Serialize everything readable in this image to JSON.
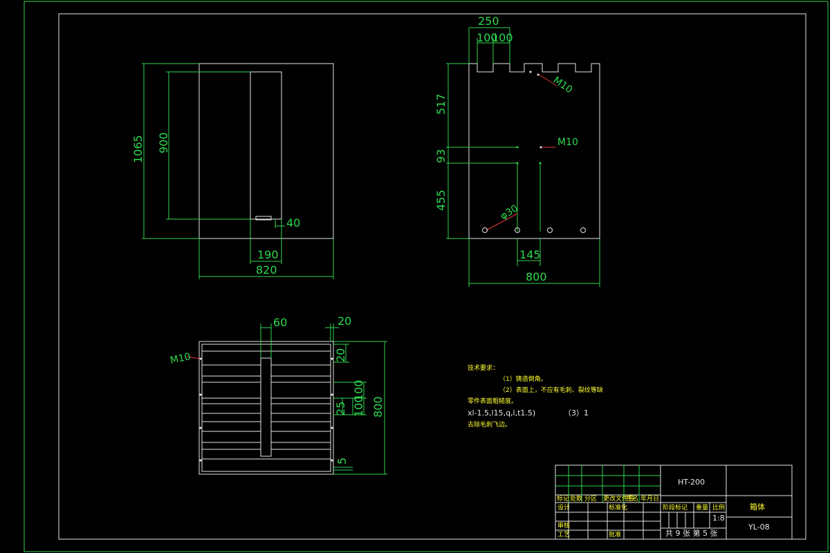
{
  "front_view": {
    "dim_height": "1065",
    "dim_inner": "900",
    "dim_gap": "40",
    "dim_slot": "190",
    "dim_width": "820"
  },
  "side_view": {
    "dim_top": "250",
    "dim_tab_a": "100",
    "dim_tab_b": "100",
    "dim_upper": "517",
    "dim_mid": "93",
    "dim_lower": "455",
    "dim_spacing": "145",
    "dim_width": "800",
    "label_m10_top": "M10",
    "label_m10_mid": "M10",
    "label_hole": "φ30"
  },
  "top_view": {
    "dim_bar": "60",
    "dim_edge": "20",
    "dim_edge_side": "20",
    "dim_a": "100",
    "dim_b": "100",
    "dim_c": "25",
    "dim_d": "5",
    "dim_depth": "800",
    "label_m10": "M10"
  },
  "notes": {
    "heading": "技术要求：",
    "line1": "（1）铸造倒角。",
    "line2": "（2）表面上，不应有毛刺、裂纹等缺",
    "line3": "零件表面粗糙度。",
    "line4": "xl-1.5,l15,q,l,t1.5)",
    "line5": "（3）1",
    "line6": "去除毛刺飞边。"
  },
  "title_block": {
    "material": "HT-200",
    "part_name": "箱体",
    "drawing_no": "YL-08",
    "scale": "1:8",
    "sheets": "共 9 张 第 5 张",
    "row_labels": [
      "标记",
      "处数",
      "分区",
      "更改文件号",
      "签名",
      "年月日"
    ],
    "role_design": "设计",
    "role_standard": "标准化",
    "role_check": "审核",
    "role_process": "工艺",
    "role_approve": "批准",
    "stage_label": "阶段标记",
    "weight_label": "重量",
    "scale_label": "比例"
  },
  "colors": {
    "outline": "#e8e8e8",
    "dimension": "#2fd84f",
    "leader": "#e23a3a",
    "note": "#ffff33"
  }
}
